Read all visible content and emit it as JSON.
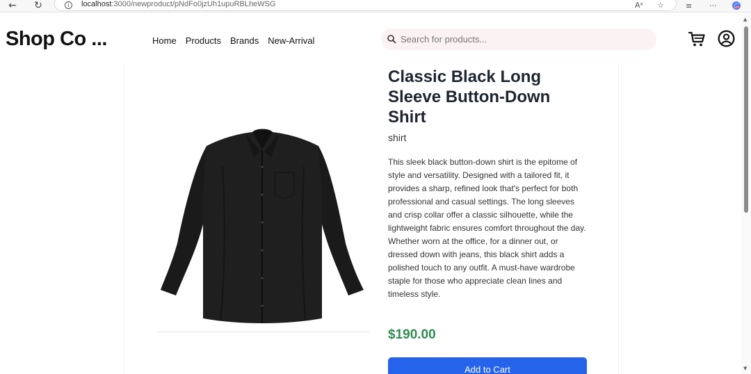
{
  "browser": {
    "url_host": "localhost",
    "url_path": ":3000/newproduct/pNdFo0jzUh1upuRBLheWSG",
    "read_aloud_label": "Aᵃ",
    "more_label": "···"
  },
  "header": {
    "logo": "Shop Co ...",
    "nav": [
      "Home",
      "Products",
      "Brands",
      "New-Arrival"
    ],
    "search_placeholder": "Search for products..."
  },
  "product": {
    "title": "Classic Black Long Sleeve Button-Down Shirt",
    "category": "shirt",
    "description": "This sleek black button-down shirt is the epitome of style and versatility. Designed with a tailored fit, it provides a sharp, refined look that's perfect for both professional and casual settings. The long sleeves and crisp collar offer a classic silhouette, while the lightweight fabric ensures comfort throughout the day. Whether worn at the office, for a dinner out, or dressed down with jeans, this black shirt adds a polished touch to any outfit. A must-have wardrobe staple for those who appreciate clean lines and timeless style.",
    "price": "$190.00",
    "add_to_cart_label": "Add to Cart"
  },
  "colors": {
    "price": "#2e8b4f",
    "button": "#2563eb",
    "search_bg": "#fbf2f4"
  },
  "icons": {
    "back": "back-arrow-icon",
    "reload": "reload-icon",
    "info": "info-icon",
    "favorite": "star-icon",
    "collections": "collections-icon",
    "copilot": "copilot-icon",
    "search": "search-icon",
    "cart": "cart-icon",
    "account": "account-icon"
  }
}
